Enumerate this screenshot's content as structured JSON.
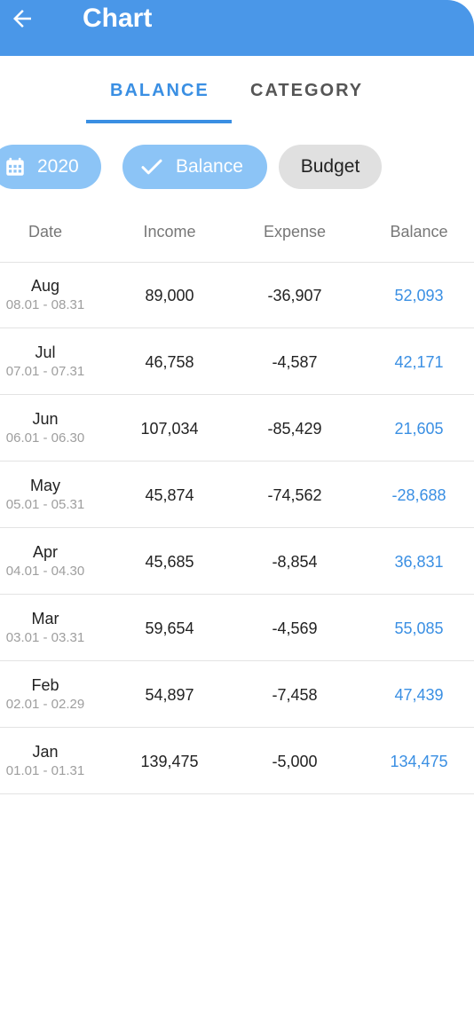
{
  "header": {
    "title": "Chart"
  },
  "tabs": [
    {
      "label": "BALANCE",
      "active": true
    },
    {
      "label": "CATEGORY",
      "active": false
    }
  ],
  "filters": {
    "year": "2020",
    "balance": "Balance",
    "budget": "Budget"
  },
  "table": {
    "columns": [
      "Date",
      "Income",
      "Expense",
      "Balance"
    ],
    "rows": [
      {
        "month": "Aug",
        "range": "08.01 - 08.31",
        "income": "89,000",
        "expense": "-36,907",
        "balance": "52,093"
      },
      {
        "month": "Jul",
        "range": "07.01 - 07.31",
        "income": "46,758",
        "expense": "-4,587",
        "balance": "42,171"
      },
      {
        "month": "Jun",
        "range": "06.01 - 06.30",
        "income": "107,034",
        "expense": "-85,429",
        "balance": "21,605"
      },
      {
        "month": "May",
        "range": "05.01 - 05.31",
        "income": "45,874",
        "expense": "-74,562",
        "balance": "-28,688"
      },
      {
        "month": "Apr",
        "range": "04.01 - 04.30",
        "income": "45,685",
        "expense": "-8,854",
        "balance": "36,831"
      },
      {
        "month": "Mar",
        "range": "03.01 - 03.31",
        "income": "59,654",
        "expense": "-4,569",
        "balance": "55,085"
      },
      {
        "month": "Feb",
        "range": "02.01 - 02.29",
        "income": "54,897",
        "expense": "-7,458",
        "balance": "47,439"
      },
      {
        "month": "Jan",
        "range": "01.01 - 01.31",
        "income": "139,475",
        "expense": "-5,000",
        "balance": "134,475"
      }
    ]
  },
  "colors": {
    "appbar": "#4a97e8",
    "accent": "#3a8fe3",
    "chip_active": "#8cc4f6",
    "chip_inactive": "#e0e0e0"
  },
  "icons": {
    "back": "arrow-left-icon",
    "calendar": "calendar-icon",
    "check": "check-icon"
  }
}
